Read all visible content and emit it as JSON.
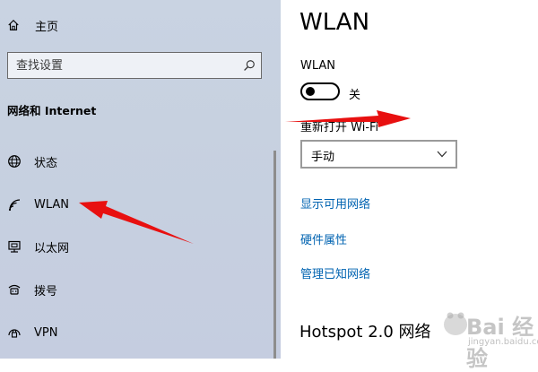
{
  "sidebar": {
    "home_label": "主页",
    "search_placeholder": "查找设置",
    "section_title": "网络和 Internet",
    "items": [
      {
        "label": "状态",
        "icon": "globe-icon"
      },
      {
        "label": "WLAN",
        "icon": "wifi-icon"
      },
      {
        "label": "以太网",
        "icon": "ethernet-icon"
      },
      {
        "label": "拨号",
        "icon": "dialup-icon"
      },
      {
        "label": "VPN",
        "icon": "vpn-icon"
      }
    ]
  },
  "main": {
    "title": "WLAN",
    "wlan_label": "WLAN",
    "toggle_state": "关",
    "toggle_on": false,
    "reopen_label": "重新打开 Wi-Fi",
    "reopen_value": "手动",
    "links": [
      "显示可用网络",
      "硬件属性",
      "管理已知网络"
    ],
    "hotspot_title": "Hotspot 2.0 网络"
  },
  "watermark": {
    "text": "Bai 经验",
    "url": "jingyan.baidu.com"
  },
  "colors": {
    "sidebar_bg": "#c8d2e1",
    "link": "#0063b1",
    "arrow": "#e81010",
    "toggle": "#000000"
  }
}
